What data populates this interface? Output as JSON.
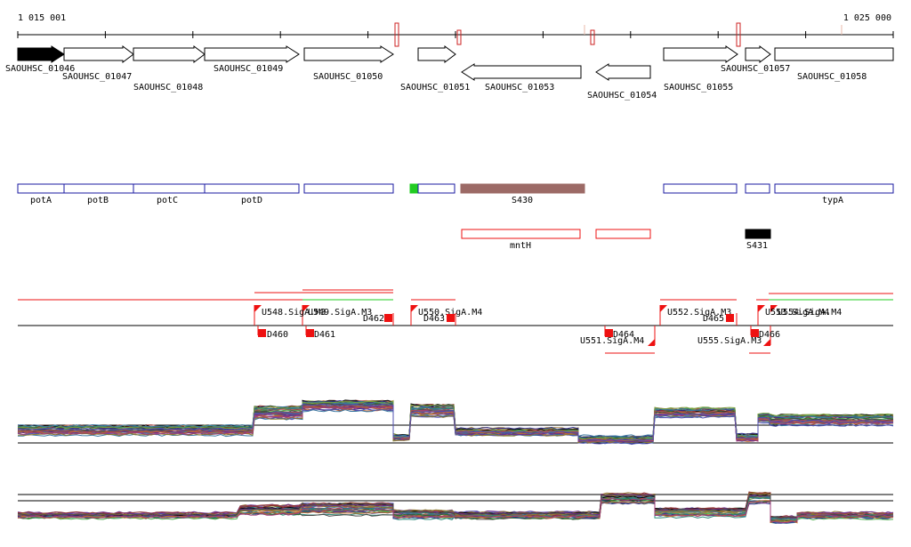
{
  "ruler": {
    "start_label": "1 015 001",
    "end_label": "1 025 000"
  },
  "genes": [
    {
      "label": "SAOUHSC_01046",
      "dir": "+",
      "filled": true
    },
    {
      "label": "SAOUHSC_01047",
      "dir": "+"
    },
    {
      "label": "SAOUHSC_01048",
      "dir": "+"
    },
    {
      "label": "SAOUHSC_01049",
      "dir": "+"
    },
    {
      "label": "SAOUHSC_01050",
      "dir": "+"
    },
    {
      "label": "SAOUHSC_01051",
      "dir": "+"
    },
    {
      "label": "SAOUHSC_01053",
      "dir": "-"
    },
    {
      "label": "SAOUHSC_01054",
      "dir": "-"
    },
    {
      "label": "SAOUHSC_01055",
      "dir": "+"
    },
    {
      "label": "SAOUHSC_01057",
      "dir": "+"
    },
    {
      "label": "SAOUHSC_01058",
      "dir": "+"
    }
  ],
  "annotations": [
    {
      "label": "potA"
    },
    {
      "label": "potB"
    },
    {
      "label": "potC"
    },
    {
      "label": "potD"
    },
    {
      "label": ""
    },
    {
      "label": ""
    },
    {
      "label": "S430",
      "color": "#9c6a66"
    },
    {
      "label": ""
    },
    {
      "label": ""
    },
    {
      "label": "typA"
    }
  ],
  "regulators": [
    {
      "label": "mntH"
    },
    {
      "label": ""
    },
    {
      "label": "S431",
      "color": "#000000"
    }
  ],
  "sites_above": [
    {
      "label": "U548.SigA.M3"
    },
    {
      "label": "U549.SigA.M3"
    },
    {
      "label": "U550.SigA.M4"
    },
    {
      "label": "U552.SigA.M3"
    },
    {
      "label": "U553.SigA.M4"
    },
    {
      "label": "U554.SigA.M4"
    }
  ],
  "sites_below": [
    {
      "label": "U551.SigA.M4"
    },
    {
      "label": "U555.SigA.M3"
    }
  ],
  "markers": [
    {
      "label": "D460"
    },
    {
      "label": "D461"
    },
    {
      "label": "D462"
    },
    {
      "label": "D463"
    },
    {
      "label": "D464"
    },
    {
      "label": "D465"
    },
    {
      "label": "D466"
    }
  ],
  "colors": {
    "annotation_border": "#1a1aa0",
    "red": "#ee1111",
    "green": "#22cc22"
  }
}
